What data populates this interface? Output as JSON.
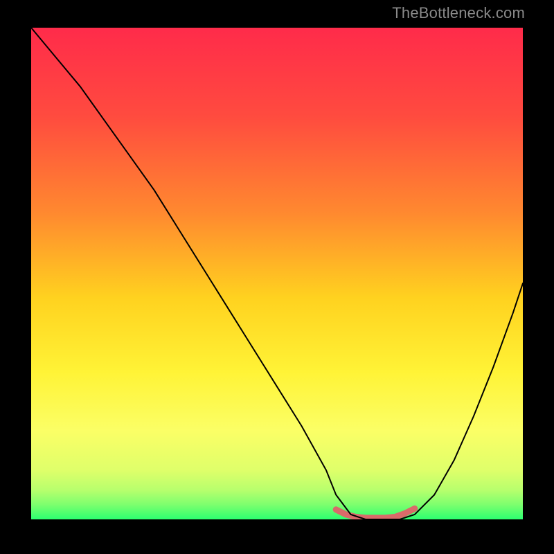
{
  "watermark": "TheBottleneck.com",
  "chart_data": {
    "type": "line",
    "title": "",
    "xlabel": "",
    "ylabel": "",
    "xlim": [
      0,
      100
    ],
    "ylim": [
      0,
      100
    ],
    "grid": false,
    "legend": false,
    "background_gradient": {
      "stops": [
        {
          "pos": 0.0,
          "color": "#ff2b4a"
        },
        {
          "pos": 0.18,
          "color": "#ff4b3f"
        },
        {
          "pos": 0.38,
          "color": "#ff8a2f"
        },
        {
          "pos": 0.55,
          "color": "#ffd21f"
        },
        {
          "pos": 0.7,
          "color": "#fff336"
        },
        {
          "pos": 0.82,
          "color": "#fbff66"
        },
        {
          "pos": 0.9,
          "color": "#dfff6a"
        },
        {
          "pos": 0.94,
          "color": "#b8ff6d"
        },
        {
          "pos": 0.97,
          "color": "#7dff6e"
        },
        {
          "pos": 1.0,
          "color": "#2cff70"
        }
      ]
    },
    "series": [
      {
        "name": "bottleneck-curve",
        "color": "#000000",
        "stroke_width": 2,
        "x": [
          0,
          5,
          10,
          15,
          20,
          25,
          30,
          35,
          40,
          45,
          50,
          55,
          60,
          62,
          65,
          68,
          72,
          75,
          78,
          82,
          86,
          90,
          94,
          98,
          100
        ],
        "y": [
          100,
          94,
          88,
          81,
          74,
          67,
          59,
          51,
          43,
          35,
          27,
          19,
          10,
          5,
          1,
          0,
          0,
          0,
          1,
          5,
          12,
          21,
          31,
          42,
          48
        ]
      },
      {
        "name": "bottleneck-flat-highlight",
        "color": "#d96a6a",
        "stroke_width": 9,
        "x": [
          62,
          64,
          66,
          68,
          70,
          72,
          74,
          76,
          78
        ],
        "y": [
          2.0,
          1.0,
          0.5,
          0.3,
          0.3,
          0.3,
          0.5,
          1.2,
          2.2
        ]
      }
    ]
  }
}
